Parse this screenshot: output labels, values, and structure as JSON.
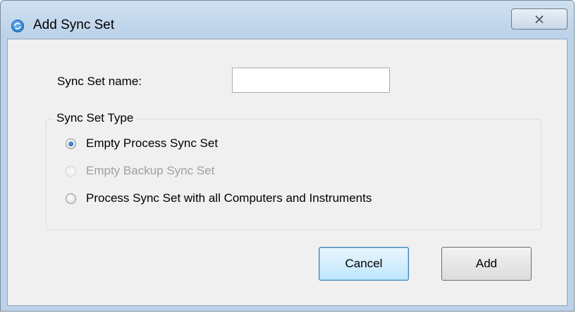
{
  "window": {
    "title": "Add Sync Set",
    "close_glyph": "☒"
  },
  "form": {
    "name_label": "Sync Set name:",
    "name_value": "",
    "name_placeholder": ""
  },
  "sync_type": {
    "legend": "Sync Set Type",
    "options": [
      {
        "label": "Empty Process Sync Set",
        "checked": true,
        "enabled": true
      },
      {
        "label": "Empty Backup Sync Set",
        "checked": false,
        "enabled": false
      },
      {
        "label": "Process Sync Set with all Computers and Instruments",
        "checked": false,
        "enabled": true
      }
    ]
  },
  "buttons": {
    "cancel_label": "Cancel",
    "add_label": "Add"
  },
  "icons": {
    "title_icon": "sync-icon",
    "close_icon": "close-icon"
  }
}
